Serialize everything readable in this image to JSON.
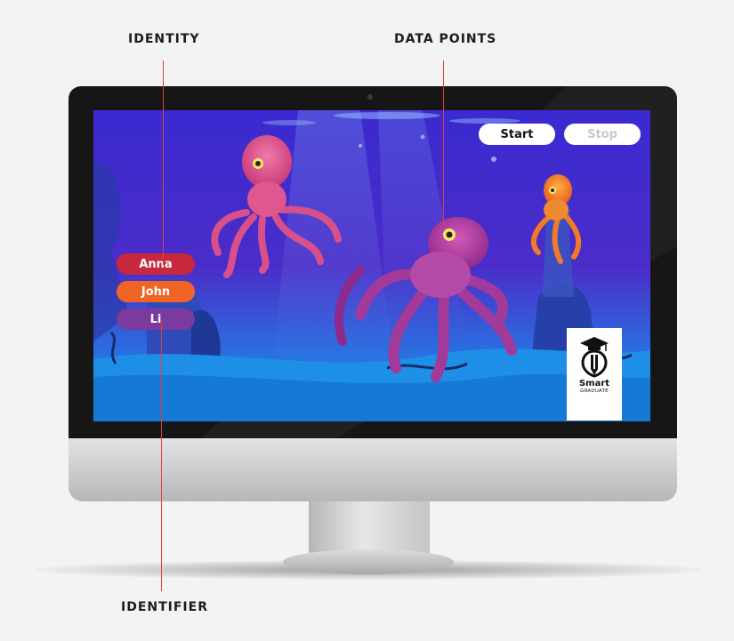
{
  "callouts": {
    "identity": "IDENTITY",
    "data_points": "DATA POINTS",
    "identifier": "IDENTIFIER"
  },
  "controls": {
    "start_label": "Start",
    "stop_label": "Stop"
  },
  "names": [
    {
      "label": "Anna",
      "color": "#c8283d"
    },
    {
      "label": "John",
      "color": "#f06425"
    },
    {
      "label": "Li",
      "color": "#7a3a9e"
    }
  ],
  "logo": {
    "line1": "Smart",
    "line2": "GRADUATE"
  },
  "colors": {
    "callout_line": "#e0403f",
    "ocean_top": "#3a2ad0",
    "ocean_bottom": "#1a7fe0"
  }
}
